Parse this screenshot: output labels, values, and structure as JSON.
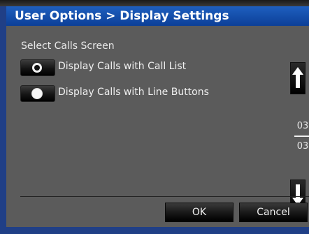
{
  "window": {
    "title": "User Options > Display Settings"
  },
  "main": {
    "heading": "Select Calls Screen",
    "options": [
      {
        "label": "Display Calls with Call List",
        "selected": false
      },
      {
        "label": "Display Calls with Line Buttons",
        "selected": true
      }
    ]
  },
  "pager": {
    "current": "03",
    "total": "03"
  },
  "scroll": {
    "up_icon": "arrow-up-icon",
    "down_icon": "arrow-down-icon"
  },
  "footer": {
    "ok_label": "OK",
    "cancel_label": "Cancel"
  },
  "colors": {
    "title_bar": "#1e5fbf",
    "panel": "#5b5b5b",
    "frame": "#203f86",
    "button": "#000000"
  }
}
